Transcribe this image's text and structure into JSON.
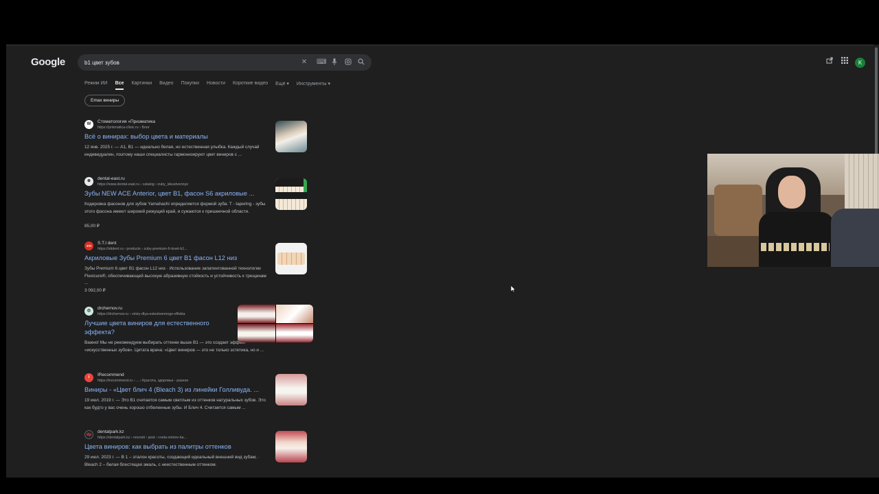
{
  "header": {
    "logo": "Google",
    "search_value": "b1 цвет зубов",
    "avatar_letter": "K"
  },
  "tabs": [
    "Режим ИИ",
    "Все",
    "Картинки",
    "Видео",
    "Покупки",
    "Новости",
    "Короткие видео",
    "Ещё ▾",
    "Инструменты ▾"
  ],
  "chip": "Emax виниры",
  "results": [
    {
      "favicon": "W",
      "site": "Стоматология «Призматика",
      "url": "https://prismatica-clinic.ru › Блог",
      "title": "Всё о винирах: выбор цвета и материалы",
      "snippet": "12 янв. 2025 г. — A1, B1 — идеально белая, но естественная улыбка. Каждый случай индивидуален, поэтому наши специалисты гармонизируют цвет виниров с ...",
      "price": ""
    },
    {
      "favicon": "⊕",
      "site": "dental-east.ru",
      "url": "https://www.dental-east.ru › catalog › zuby_iskustvennye",
      "title": "Зубы NEW ACE Anterior, цвет B1, фасон S6 акриловые ...",
      "snippet": "Кодировка фасонов для зубов Yamahachi определяется формой зуба: T - tapering - зубы этого фасона имеют широкий режущий край, и сужаются к пришеечной области.",
      "price": "85,00 ₽"
    },
    {
      "favicon": "STI",
      "site": "S.T.I dent",
      "url": "https://stident.ru › products › zuby-premium-6-tsvet-b1...",
      "title": "Акриловые Зубы Premium 6 цвет B1 фасон L12 низ",
      "snippet": "Зубы Premium 6 цвет B1 фасон L12 низ · Использование запатентованной технологии Flexicure®, обеспечивающей высокую абразивную стойкость и устойчивость к трещинам ...",
      "price": "3 092,00 ₽"
    },
    {
      "favicon": "◎",
      "site": "drchernov.ru",
      "url": "https://drchernov.ru › viniry-dlya-estestvennogo-effekta",
      "title": "Лучшие цвета виниров для естественного",
      "title2": "эффекта?",
      "snippet": "Важно! Мы не рекомендуем выбирать оттенки выше B1 — это создает эффект «искусственных зубов». Цитата врача: «Цвет виниров — это не только эстетика, но и ...",
      "price": ""
    },
    {
      "favicon": "i",
      "site": "IRecommend",
      "url": "https://irecommend.ru › ... › Красота, здоровье - разное",
      "title": "Виниры - «Цвет блич 4 (Bleach 3) из линейки Голливуда. ...",
      "snippet": "19 июл. 2019 г. — Это B1 считается самым светлым из оттенков натуральных зубов. Это как будто у вас очень хорошо отбеленные зубы. И Блич 4. Считается самым ...",
      "price": ""
    },
    {
      "favicon": "dp",
      "site": "dentalpark.kz",
      "url": "https://dentalpark.kz › novosti › post › cveta-vinirov-ka...",
      "title": "Цвета виниров: как выбрать из палитры оттенков",
      "snippet": "29 июл. 2023 г. — B 1 – эталон красоты, создающий идеальный внешний вид зубам; · Bleach 2 – белая блестящая эмаль, с неестественным оттенком.",
      "price": ""
    }
  ],
  "colors": {
    "background": "#1f1f1f",
    "link": "#8ab4f8",
    "text": "#bdc1c6",
    "avatar": "#188038"
  }
}
